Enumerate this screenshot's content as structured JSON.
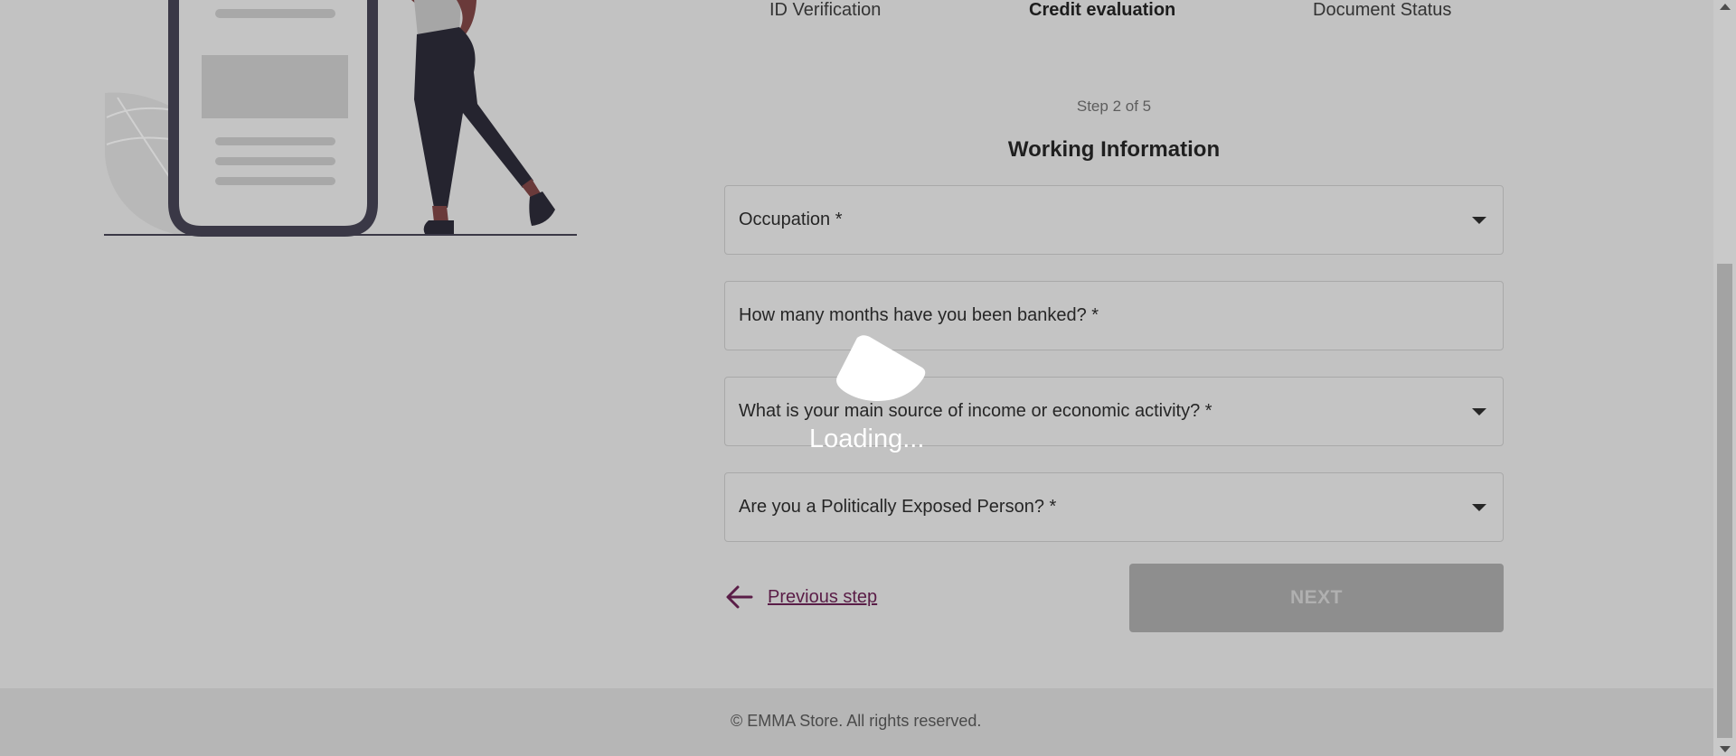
{
  "stepper": {
    "tabs": [
      {
        "label": "ID Verification"
      },
      {
        "label": "Credit evaluation",
        "active": true
      },
      {
        "label": "Document Status"
      }
    ]
  },
  "form": {
    "step_text": "Step 2 of 5",
    "title": "Working Information",
    "fields": [
      {
        "label": "Occupation *",
        "type": "select"
      },
      {
        "label": "How many months have you been banked? *",
        "type": "text"
      },
      {
        "label": "What is your main source of income or economic activity? *",
        "type": "select"
      },
      {
        "label": "Are you a Politically Exposed Person? *",
        "type": "select"
      }
    ]
  },
  "actions": {
    "previous_label": "Previous step",
    "next_label": "NEXT"
  },
  "overlay": {
    "loading_text": "Loading..."
  },
  "footer": {
    "copyright": "© EMMA Store. All rights reserved."
  },
  "colors": {
    "link": "#5a1d47",
    "background": "#c2c2c2",
    "button_disabled": "#8e8e8e"
  }
}
